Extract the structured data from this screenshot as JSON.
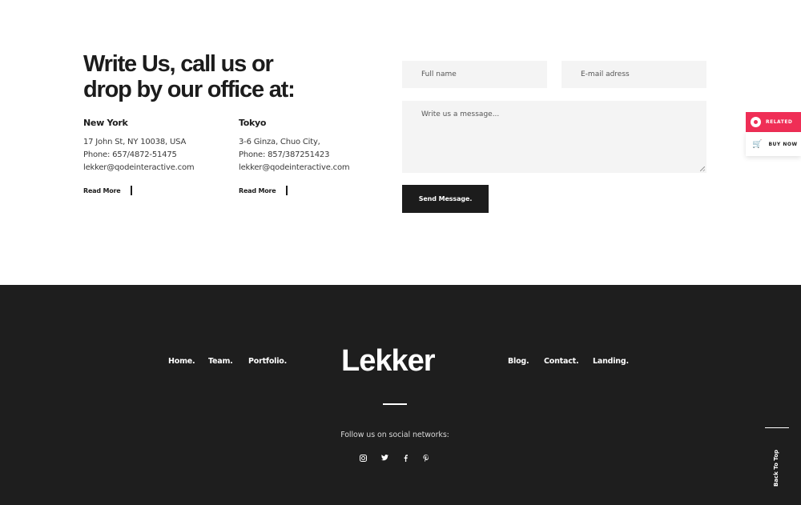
{
  "contact": {
    "heading_line1": "Write Us, call us or",
    "heading_line2": "drop by our office at:",
    "offices": [
      {
        "city": "New York",
        "address": "17 John St, NY 10038, USA",
        "phone": "Phone: 657/4872-51475",
        "email": "lekker@qodeinteractive.com",
        "link": "Read More"
      },
      {
        "city": "Tokyo",
        "address": "3-6 Ginza, Chuo City,",
        "phone": "Phone: 857/387251423",
        "email": "lekker@qodeinteractive.com",
        "link": "Read More"
      }
    ]
  },
  "form": {
    "name_placeholder": "Full name",
    "email_placeholder": "E-mail adress",
    "message_placeholder": "Write us a message...",
    "submit_label": "Send Message."
  },
  "side_widget": {
    "related_label": "RELATED",
    "buy_label": "BUY NOW",
    "accent": "#ef2e56"
  },
  "footer": {
    "nav_left": [
      "Home.",
      "Team.",
      "Portfolio."
    ],
    "logo": "Lekker",
    "nav_right": [
      "Blog.",
      "Contact.",
      "Landing."
    ],
    "follow_text": "Follow us on social networks:",
    "social": [
      {
        "name": "instagram-icon",
        "glyph": "◘"
      },
      {
        "name": "twitter-icon",
        "glyph": "🐦"
      },
      {
        "name": "facebook-icon",
        "glyph": "f"
      },
      {
        "name": "pinterest-icon",
        "glyph": "℗"
      }
    ],
    "back_to_top": "Back To Top",
    "background": "#1e1e1e"
  }
}
